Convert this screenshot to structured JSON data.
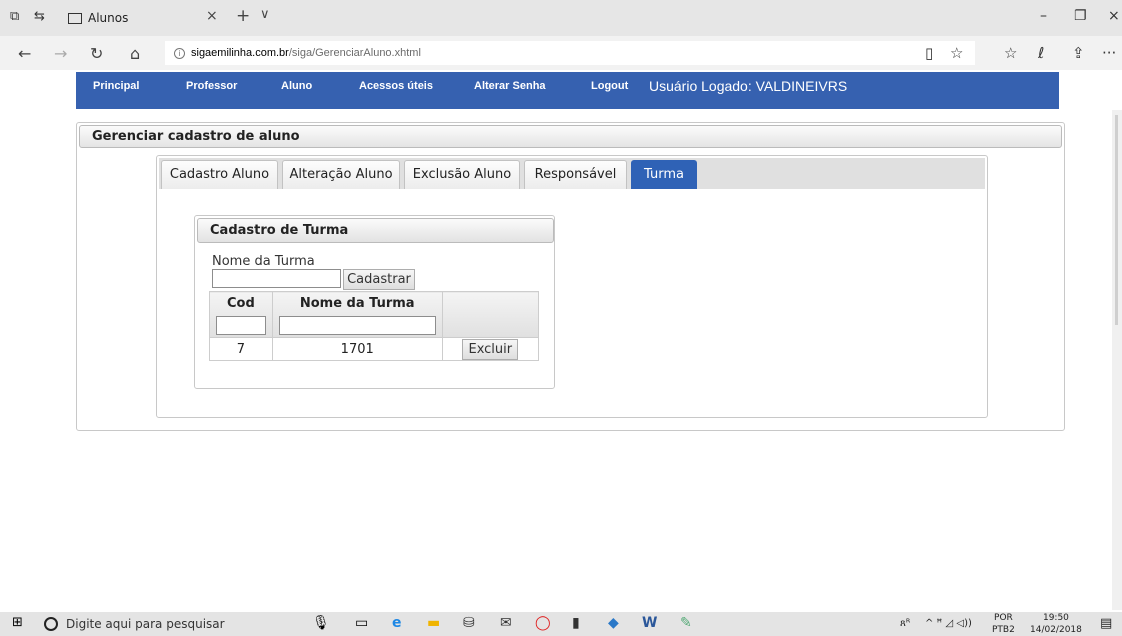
{
  "browser": {
    "tab_title": "Alunos",
    "close_glyph": "×",
    "newtab_glyph": "+",
    "tabmenu_glyph": "∨",
    "url_host": "sigaemilinha.com.br",
    "url_path": "/siga/GerenciarAluno.xhtml",
    "icons": {
      "back": "←",
      "forward": "→",
      "refresh": "↻",
      "home": "⌂",
      "info": "i",
      "reading": "▯",
      "star": "☆",
      "favorites": "☆",
      "pen": "ℓ",
      "share": "⇪",
      "more": "···",
      "min": "–",
      "max": "❐",
      "close": "×"
    }
  },
  "appnav": {
    "items": [
      "Principal",
      "Professor",
      "Aluno",
      "Acessos úteis",
      "Alterar Senha",
      "Logout"
    ],
    "user": "Usuário Logado: VALDINEIVRS"
  },
  "panel": {
    "title": "Gerenciar cadastro de aluno",
    "tabs": [
      "Cadastro Aluno",
      "Alteração Aluno",
      "Exclusão Aluno",
      "Responsável",
      "Turma"
    ],
    "selected_tab": "Turma",
    "turma": {
      "legend": "Cadastro de Turma",
      "name_label": "Nome da Turma",
      "name_value": "",
      "submit_label": "Cadastrar",
      "columns": [
        "Cod",
        "Nome da Turma",
        ""
      ],
      "filter_cod": "",
      "filter_nome": "",
      "rows": [
        {
          "cod": "7",
          "nome": "1701",
          "action": "Excluir"
        }
      ]
    }
  },
  "taskbar": {
    "search_placeholder": "Digite aqui para pesquisar",
    "lang_line1": "POR",
    "lang_line2": "PTB2",
    "time": "19:50",
    "date": "14/02/2018",
    "tray_user": "ጸᴿ",
    "tray_icons": "^ ꟸ ◿ ◁))",
    "notif": "▤"
  },
  "colors": {
    "nav_blue": "#3661b0",
    "tab_selected": "#2f62b6"
  }
}
